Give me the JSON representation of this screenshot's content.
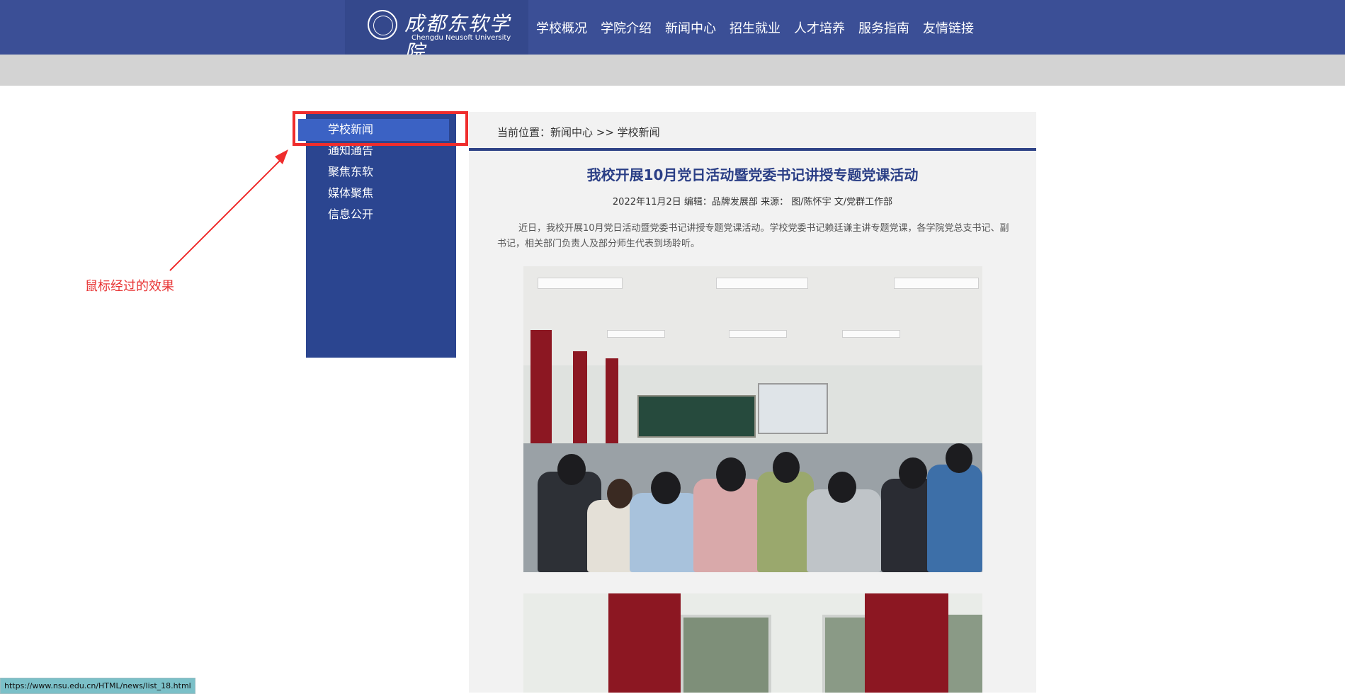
{
  "header": {
    "logo_cn": "成都东软学院",
    "logo_en": "Chengdu Neusoft University",
    "nav": [
      "学校概况",
      "学院介绍",
      "新闻中心",
      "招生就业",
      "人才培养",
      "服务指南",
      "友情链接"
    ]
  },
  "sidebar": {
    "items": [
      "学校新闻",
      "通知通告",
      "聚焦东软",
      "媒体聚焦",
      "信息公开"
    ],
    "active_index": 0
  },
  "content": {
    "breadcrumb": "当前位置：新闻中心 >> 学校新闻",
    "title": "我校开展10月党日活动暨党委书记讲授专题党课活动",
    "meta": "2022年11月2日 编辑：品牌发展部 来源： 图/陈怀宇 文/党群工作部",
    "body": "近日，我校开展10月党日活动暨党委书记讲授专题党课活动。学校党委书记赖廷谦主讲专题党课，各学院党总支书记、副书记，相关部门负责人及部分师生代表到场聆听。"
  },
  "annotation": {
    "text": "鼠标经过的效果"
  },
  "status_bar": {
    "url": "https://www.nsu.edu.cn/HTML/news/list_18.html"
  },
  "colors": {
    "header": "#3b4f96",
    "sidebar": "#2b4590",
    "active": "#3b62c4",
    "annotation_red": "#ef2d2d",
    "title_blue": "#2b3f86"
  }
}
